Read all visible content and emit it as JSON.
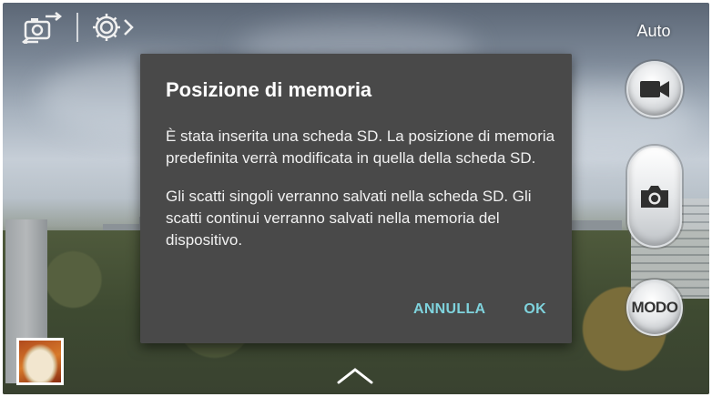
{
  "camera": {
    "flash_mode_label": "Auto",
    "mode_button_label": "MODO",
    "icons": {
      "switch_camera": "switch-camera-icon",
      "settings": "settings-gear-icon",
      "video": "video-camera-icon",
      "shutter": "camera-icon",
      "expand": "chevron-up-icon"
    }
  },
  "dialog": {
    "title": "Posizione di memoria",
    "paragraph_1": "È stata inserita una scheda SD. La posizione di memoria predefinita verrà modificata in quella della scheda SD.",
    "paragraph_2": "Gli scatti singoli verranno salvati nella scheda SD. Gli scatti continui verranno salvati nella memoria del dispositivo.",
    "cancel_label": "ANNULLA",
    "ok_label": "OK",
    "accent_color": "#7fd3dd",
    "background_color": "#494949"
  }
}
